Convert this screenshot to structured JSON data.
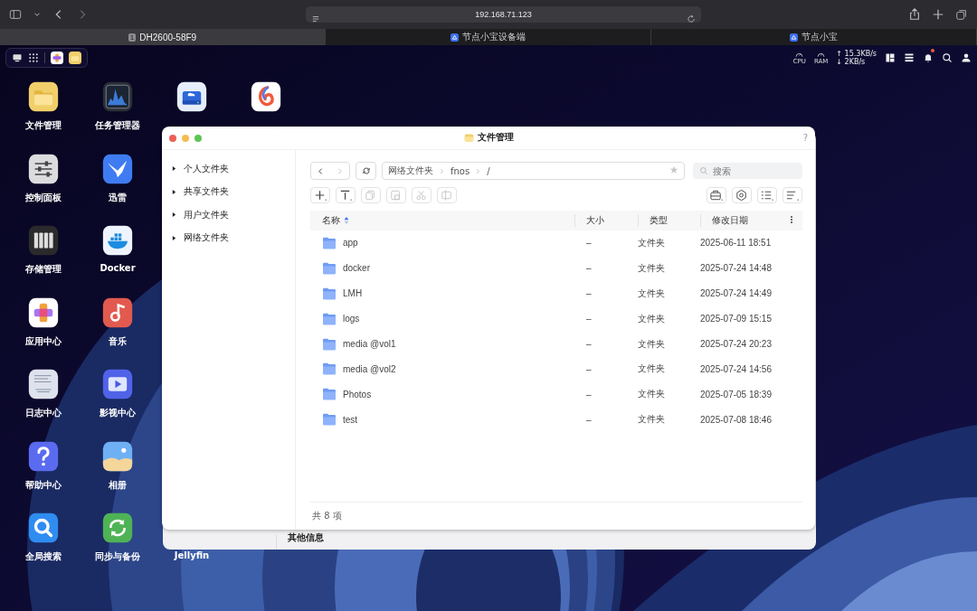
{
  "browser": {
    "url": "192.168.71.123",
    "tabs": [
      {
        "title": "DH2600-58F9",
        "badge": "1",
        "selected": true
      },
      {
        "title": "节点小宝设备端",
        "selected": false
      },
      {
        "title": "节点小宝",
        "selected": false
      }
    ]
  },
  "top_panel": {
    "cpu_label": "CPU",
    "ram_label": "RAM",
    "upload": "↑ 15.3KB/s",
    "download": "↓ 2KB/s",
    "notification": true
  },
  "desktop_columns": [
    [
      {
        "label": "文件管理",
        "kind": "files"
      },
      {
        "label": "控制面板",
        "kind": "sliders"
      },
      {
        "label": "存储管理",
        "kind": "storage"
      },
      {
        "label": "应用中心",
        "kind": "apps"
      },
      {
        "label": "日志中心",
        "kind": "logs"
      },
      {
        "label": "帮助中心",
        "kind": "help"
      },
      {
        "label": "全局搜索",
        "kind": "search"
      }
    ],
    [
      {
        "label": "任务管理器",
        "kind": "activity"
      },
      {
        "label": "迅雷",
        "kind": "bird"
      },
      {
        "label": "Docker",
        "kind": "docker"
      },
      {
        "label": "音乐",
        "kind": "music"
      },
      {
        "label": "影视中心",
        "kind": "video"
      },
      {
        "label": "相册",
        "kind": "photos"
      },
      {
        "label": "同步与备份",
        "kind": "sync"
      }
    ],
    [
      {
        "kind": "drive"
      },
      {
        "label": "Jellyfin"
      }
    ],
    [
      {
        "kind": "swirl"
      }
    ]
  ],
  "background_window": {
    "text": "其他信息"
  },
  "file_window": {
    "title": "文件管理",
    "help": "?",
    "sidebar": [
      {
        "label": "个人文件夹",
        "expanded": false
      },
      {
        "label": "共享文件夹",
        "expanded": false
      },
      {
        "label": "用户文件夹",
        "expanded": false
      },
      {
        "label": "网络文件夹",
        "expanded": false
      }
    ],
    "breadcrumb": [
      "网络文件夹",
      "fnos",
      "/"
    ],
    "search": {
      "placeholder": "搜索"
    },
    "toolbar": [
      {
        "kind": "new",
        "disabled": false
      },
      {
        "kind": "upload",
        "disabled": false
      },
      {
        "kind": "copy",
        "disabled": true
      },
      {
        "kind": "paste",
        "disabled": true
      },
      {
        "kind": "cut",
        "disabled": true
      },
      {
        "kind": "rename",
        "disabled": true
      }
    ],
    "toolbar_right": [
      {
        "kind": "tools"
      },
      {
        "kind": "settings"
      },
      {
        "kind": "view"
      },
      {
        "kind": "sort"
      }
    ],
    "columns": [
      "名称",
      "大小",
      "类型",
      "修改日期"
    ],
    "rows": [
      {
        "name": "app",
        "size": "–",
        "type": "文件夹",
        "modified": "2025-06-11 18:51"
      },
      {
        "name": "docker",
        "size": "–",
        "type": "文件夹",
        "modified": "2025-07-24 14:48"
      },
      {
        "name": "LMH",
        "size": "–",
        "type": "文件夹",
        "modified": "2025-07-24 14:49"
      },
      {
        "name": "logs",
        "size": "–",
        "type": "文件夹",
        "modified": "2025-07-09 15:15"
      },
      {
        "name": "media @vol1",
        "size": "–",
        "type": "文件夹",
        "modified": "2025-07-24 20:23"
      },
      {
        "name": "media @vol2",
        "size": "–",
        "type": "文件夹",
        "modified": "2025-07-24 14:56"
      },
      {
        "name": "Photos",
        "size": "–",
        "type": "文件夹",
        "modified": "2025-07-05 18:39"
      },
      {
        "name": "test",
        "size": "–",
        "type": "文件夹",
        "modified": "2025-07-08 18:46"
      }
    ],
    "footer": "共 8 项"
  }
}
